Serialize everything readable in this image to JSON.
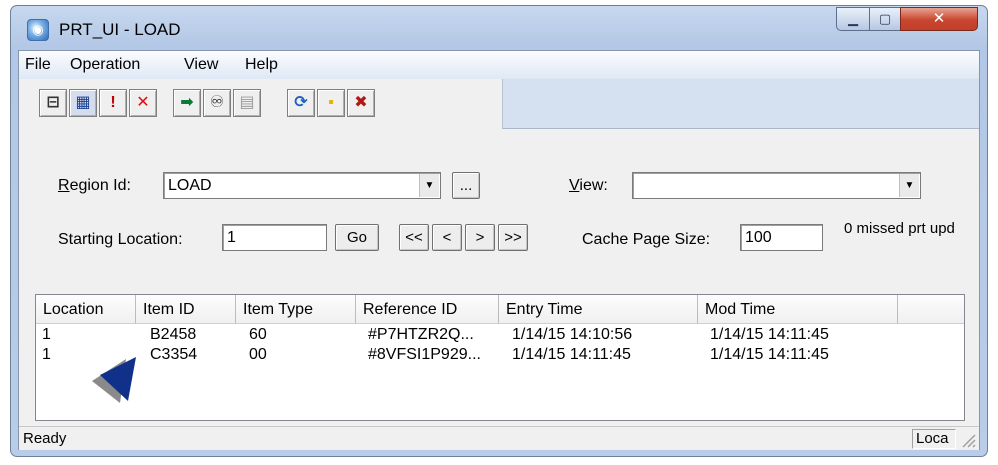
{
  "window": {
    "title": "PRT_UI - LOAD",
    "caption_buttons": {
      "minimize": "▁",
      "maximize": "▢",
      "close": "✕"
    }
  },
  "menu": [
    "File",
    "Operation",
    "View",
    "Help"
  ],
  "toolbar": {
    "buttons": [
      {
        "icon": "new-record-icon",
        "glyph": "⊟"
      },
      {
        "icon": "calendar-icon",
        "glyph": "▦"
      },
      {
        "icon": "alert-document-icon",
        "glyph": "!"
      },
      {
        "icon": "delete-icon",
        "glyph": "✕"
      },
      {
        "icon": "go-arrow-icon",
        "glyph": "➡"
      },
      {
        "icon": "binoculars-icon",
        "glyph": "♾"
      },
      {
        "icon": "find-next-icon",
        "glyph": "▤"
      },
      {
        "icon": "refresh-icon",
        "glyph": "⟳"
      },
      {
        "icon": "lock-icon",
        "glyph": "▪"
      },
      {
        "icon": "clear-icon",
        "glyph": "✖"
      }
    ]
  },
  "form": {
    "region_label_u": "R",
    "region_label_rest": "egion Id:",
    "region_value": "LOAD",
    "ellipsis": "...",
    "view_label_u": "V",
    "view_label_rest": "iew:",
    "view_value": "",
    "starting_location_label": "Starting Location:",
    "starting_location_value": "1",
    "go": "Go",
    "nav": [
      "<<",
      "<",
      ">",
      ">>"
    ],
    "cache_page_size_label": "Cache Page Size:",
    "cache_page_size_value": "100",
    "missed_text": "0 missed prt upd"
  },
  "table": {
    "columns": [
      "Location",
      "Item ID",
      "Item Type",
      "Reference ID",
      "Entry Time",
      "Mod Time"
    ],
    "rows": [
      [
        "1",
        "B2458",
        "60",
        "#P7HTZR2Q...",
        "1/14/15 14:10:56",
        "1/14/15 14:11:45"
      ],
      [
        "1",
        "C3354",
        "00",
        "#8VFSI1P929...",
        "1/14/15 14:11:45",
        "1/14/15 14:11:45"
      ]
    ]
  },
  "status": {
    "text": "Ready",
    "pane2": "Loca"
  },
  "colors": {
    "cursor_blue": "#10308a",
    "cursor_shadow": "#8a8a8a",
    "close_red": "#c8462e"
  }
}
